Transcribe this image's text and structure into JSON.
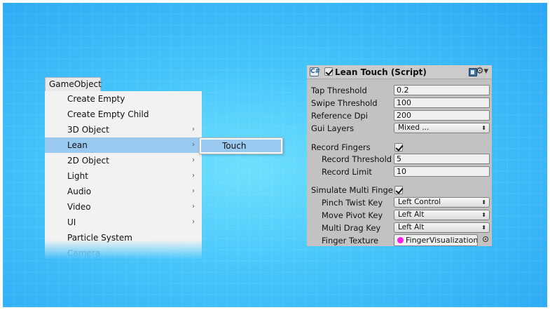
{
  "menu": {
    "header": "GameObject",
    "items": [
      {
        "label": "Create Empty"
      },
      {
        "label": "Create Empty Child"
      },
      {
        "label": "3D Object",
        "arrow": "›"
      },
      {
        "label": "Lean",
        "arrow": "›"
      },
      {
        "label": "2D Object",
        "arrow": "›"
      },
      {
        "label": "Light",
        "arrow": "›"
      },
      {
        "label": "Audio",
        "arrow": "›"
      },
      {
        "label": "Video",
        "arrow": "›"
      },
      {
        "label": "UI",
        "arrow": "›"
      },
      {
        "label": "Particle System"
      },
      {
        "label": "Camera"
      }
    ],
    "submenu": {
      "label": "Touch"
    }
  },
  "inspector": {
    "title": "Lean Touch (Script)",
    "script_icon": "C#",
    "gear": "⚙▾",
    "updown": "⬍",
    "rows": [
      {
        "label": "Tap Threshold",
        "value": "0.2"
      },
      {
        "label": "Swipe Threshold",
        "value": "100"
      },
      {
        "label": "Reference Dpi",
        "value": "200"
      },
      {
        "label": "Gui Layers",
        "value": "Mixed ..."
      },
      {
        "label": "Record Fingers"
      },
      {
        "label": "Record Threshold",
        "value": "5"
      },
      {
        "label": "Record Limit",
        "value": "10"
      },
      {
        "label": "Simulate Multi Fingers"
      },
      {
        "label": "Pinch Twist Key",
        "value": "Left Control"
      },
      {
        "label": "Move Pivot Key",
        "value": "Left Alt"
      },
      {
        "label": "Multi Drag Key",
        "value": "Left Alt"
      },
      {
        "label": "Finger Texture",
        "value": "FingerVisualization"
      }
    ]
  }
}
